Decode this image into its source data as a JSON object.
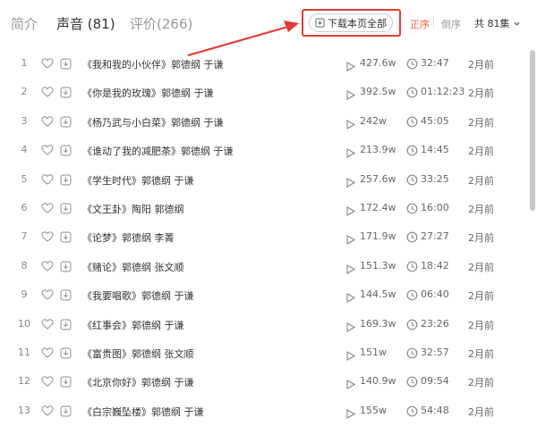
{
  "tabs": [
    {
      "label": "简介",
      "active": false
    },
    {
      "label": "声音 (81)",
      "active": true
    },
    {
      "label": "评价(266)",
      "active": false
    }
  ],
  "toolbar": {
    "download_all_label": "下载本页全部",
    "sort_asc_label": "正序",
    "sort_desc_label": "倒序",
    "total_label": "共 81集"
  },
  "colors": {
    "accent": "#f86442",
    "highlight_box": "#e53935"
  },
  "icons": {
    "row_like": "heart-icon",
    "row_download": "download-icon",
    "row_play": "play-icon",
    "row_duration": "clock-icon",
    "total_dropdown": "chevron-down-icon"
  },
  "tracks": [
    {
      "index": "1",
      "title": "《我和我的小伙伴》郭德纲 于谦",
      "plays": "427.6w",
      "duration": "32:47",
      "date": "2月前"
    },
    {
      "index": "2",
      "title": "《你是我的玫瑰》郭德纲 于谦",
      "plays": "392.5w",
      "duration": "01:12:23",
      "date": "2月前"
    },
    {
      "index": "3",
      "title": "《杨乃武与小白菜》郭德纲 于谦",
      "plays": "242w",
      "duration": "45:05",
      "date": "2月前"
    },
    {
      "index": "4",
      "title": "《谁动了我的减肥茶》郭德纲 于谦",
      "plays": "213.9w",
      "duration": "14:45",
      "date": "2月前"
    },
    {
      "index": "5",
      "title": "《学生时代》郭德纲 于谦",
      "plays": "257.6w",
      "duration": "33:25",
      "date": "2月前"
    },
    {
      "index": "6",
      "title": "《文王卦》陶阳 郭德纲",
      "plays": "172.4w",
      "duration": "16:00",
      "date": "2月前"
    },
    {
      "index": "7",
      "title": "《论梦》郭德纲 李菁",
      "plays": "171.9w",
      "duration": "27:27",
      "date": "2月前"
    },
    {
      "index": "8",
      "title": "《赌论》郭德纲 张文顺",
      "plays": "151.3w",
      "duration": "18:42",
      "date": "2月前"
    },
    {
      "index": "9",
      "title": "《我要唱歌》郭德纲 于谦",
      "plays": "144.5w",
      "duration": "06:40",
      "date": "2月前"
    },
    {
      "index": "10",
      "title": "《红事会》郭德纲 于谦",
      "plays": "169.3w",
      "duration": "23:26",
      "date": "2月前"
    },
    {
      "index": "11",
      "title": "《富贵图》郭德纲 张文顺",
      "plays": "151w",
      "duration": "32:57",
      "date": "2月前"
    },
    {
      "index": "12",
      "title": "《北京你好》郭德纲 于谦",
      "plays": "140.9w",
      "duration": "09:54",
      "date": "2月前"
    },
    {
      "index": "13",
      "title": "《白宗巍坠楼》郭德纲 于谦",
      "plays": "155w",
      "duration": "54:48",
      "date": "2月前"
    }
  ]
}
